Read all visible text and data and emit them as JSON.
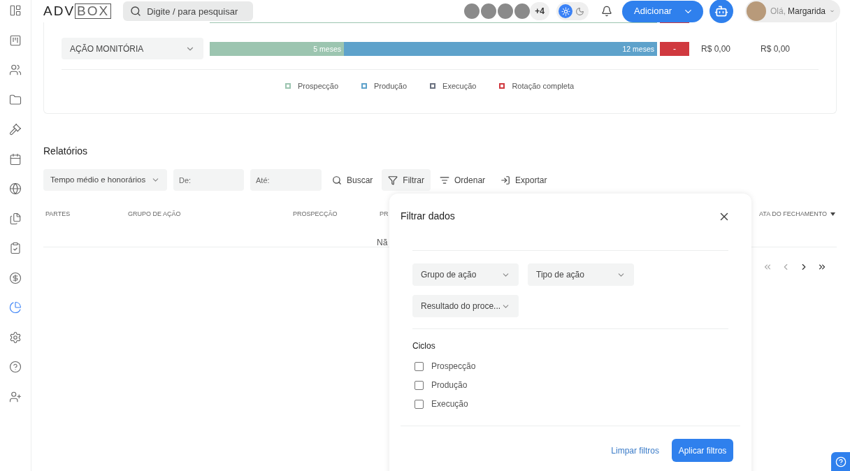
{
  "sidebar": {
    "items": [
      {
        "selected": false
      },
      {
        "selected": false
      },
      {
        "selected": false
      },
      {
        "selected": false
      },
      {
        "selected": false
      },
      {
        "selected": false
      },
      {
        "selected": false
      },
      {
        "selected": false
      },
      {
        "selected": false
      },
      {
        "selected": false
      },
      {
        "selected": true
      },
      {
        "selected": false
      },
      {
        "selected": false
      },
      {
        "selected": false
      }
    ]
  },
  "header": {
    "logo": {
      "left": "ADV",
      "boxed": "BOX"
    },
    "search": {
      "placeholder": "Digite / para pesquisar"
    },
    "avatars_more": "+4",
    "theme": {
      "dark": false
    },
    "add_button": "Adicionar",
    "greeting": "Olá,",
    "user_name": "Margarida"
  },
  "timeline": {
    "rows": [
      {
        "bar": {
          "level": 1
        }
      },
      {
        "group": "AÇÃO MONITÓRIA",
        "bar": {
          "level": 0.3,
          "fill_label": "5 meses",
          "rest_label": "12 meses"
        },
        "rotation": "-",
        "value_1": "R$ 0,00",
        "value_2": "R$ 0,00"
      }
    ],
    "legend": [
      {
        "label": "Prospecção",
        "color": "#9cc5b0"
      },
      {
        "label": "Produção",
        "color": "#5ea2cb"
      },
      {
        "label": "Execução",
        "color": "#6b7280"
      },
      {
        "label": "Rotação completa",
        "color": "#d0393f"
      }
    ]
  },
  "reports": {
    "title": "Relatórios",
    "report_select": "Tempo médio e honorários",
    "from": {
      "placeholder": "De:"
    },
    "to": {
      "placeholder": "Até:"
    },
    "actions": [
      {
        "label": "Buscar",
        "selected": false
      },
      {
        "label": "Filtrar",
        "selected": true
      },
      {
        "label": "Ordenar",
        "selected": false
      },
      {
        "label": "Exportar",
        "selected": false
      }
    ],
    "columns": [
      "PARTES",
      "GRUPO DE AÇÃO",
      "PROSPECÇÃO",
      "PR"
    ],
    "sorted_column": "ATA DO FECHAMENTO",
    "empty_text": "Nã"
  },
  "filter_dialog": {
    "title": "Filtrar dados",
    "selects": [
      "Grupo de ação",
      "Tipo de ação",
      "Resultado do proce..."
    ],
    "cycles_title": "Ciclos",
    "cycles": [
      {
        "label": "Prospecção",
        "checked": false
      },
      {
        "label": "Produção",
        "checked": false
      },
      {
        "label": "Execução",
        "checked": false
      }
    ],
    "clear_button": "Limpar filtros",
    "apply_button": "Aplicar filtros"
  }
}
